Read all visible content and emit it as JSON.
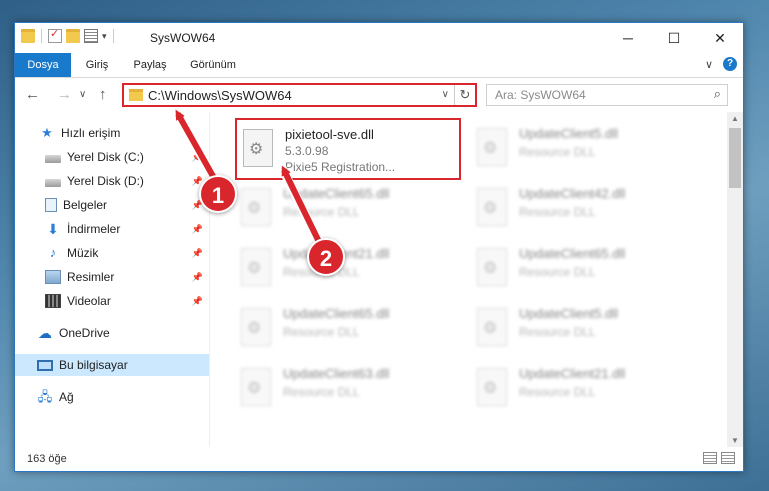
{
  "window": {
    "title": "SysWOW64",
    "controls": {
      "minimize": "─",
      "maximize": "☐",
      "close": "✕"
    }
  },
  "ribbon": {
    "tabs": [
      "Dosya",
      "Giriş",
      "Paylaş",
      "Görünüm"
    ],
    "expand": "∨",
    "help": "?"
  },
  "nav": {
    "back": "←",
    "forward": "→",
    "recent": "∨",
    "up": "↑",
    "address": "C:\\Windows\\SysWOW64",
    "address_dropdown": "∨",
    "refresh": "↻",
    "search_placeholder": "Ara: SysWOW64",
    "search_icon": "⌕"
  },
  "sidebar": {
    "items": [
      {
        "label": "Hızlı erişim",
        "icon": "star-icon",
        "pinned": false
      },
      {
        "label": "Yerel Disk (C:)",
        "icon": "drive-icon",
        "pinned": true
      },
      {
        "label": "Yerel Disk (D:)",
        "icon": "drive-icon",
        "pinned": true
      },
      {
        "label": "Belgeler",
        "icon": "documents-icon",
        "pinned": true
      },
      {
        "label": "İndirmeler",
        "icon": "download-icon",
        "pinned": true
      },
      {
        "label": "Müzik",
        "icon": "music-icon",
        "pinned": true
      },
      {
        "label": "Resimler",
        "icon": "pictures-icon",
        "pinned": true
      },
      {
        "label": "Videolar",
        "icon": "videos-icon",
        "pinned": true
      },
      {
        "label": "OneDrive",
        "icon": "cloud-icon",
        "pinned": false
      },
      {
        "label": "Bu bilgisayar",
        "icon": "computer-icon",
        "pinned": false,
        "selected": true
      },
      {
        "label": "Ağ",
        "icon": "network-icon",
        "pinned": false
      }
    ]
  },
  "files": [
    {
      "name": "pixietool-sve.dll",
      "line1": "5.3.0.98",
      "line2": "Pixie5 Registration...",
      "highlighted": true
    },
    {
      "name": "UpdateClient5.dll",
      "line1": "Resource DLL",
      "line2": ""
    },
    {
      "name": "UpdateClient65.dll",
      "line1": "Resource DLL",
      "line2": ""
    },
    {
      "name": "UpdateClient42.dll",
      "line1": "Resource DLL",
      "line2": ""
    },
    {
      "name": "UpdateClient21.dll",
      "line1": "Resource DLL",
      "line2": ""
    },
    {
      "name": "UpdateClient65.dll",
      "line1": "Resource DLL",
      "line2": ""
    },
    {
      "name": "UpdateClient65.dll",
      "line1": "Resource DLL",
      "line2": ""
    },
    {
      "name": "UpdateClient5.dll",
      "line1": "Resource DLL",
      "line2": ""
    },
    {
      "name": "UpdateClient63.dll",
      "line1": "Resource DLL",
      "line2": ""
    },
    {
      "name": "UpdateClient21.dll",
      "line1": "Resource DLL",
      "line2": ""
    }
  ],
  "status": {
    "count": "163 öğe"
  },
  "annotations": {
    "badge1": "1",
    "badge2": "2",
    "accent": "#d9262d"
  }
}
